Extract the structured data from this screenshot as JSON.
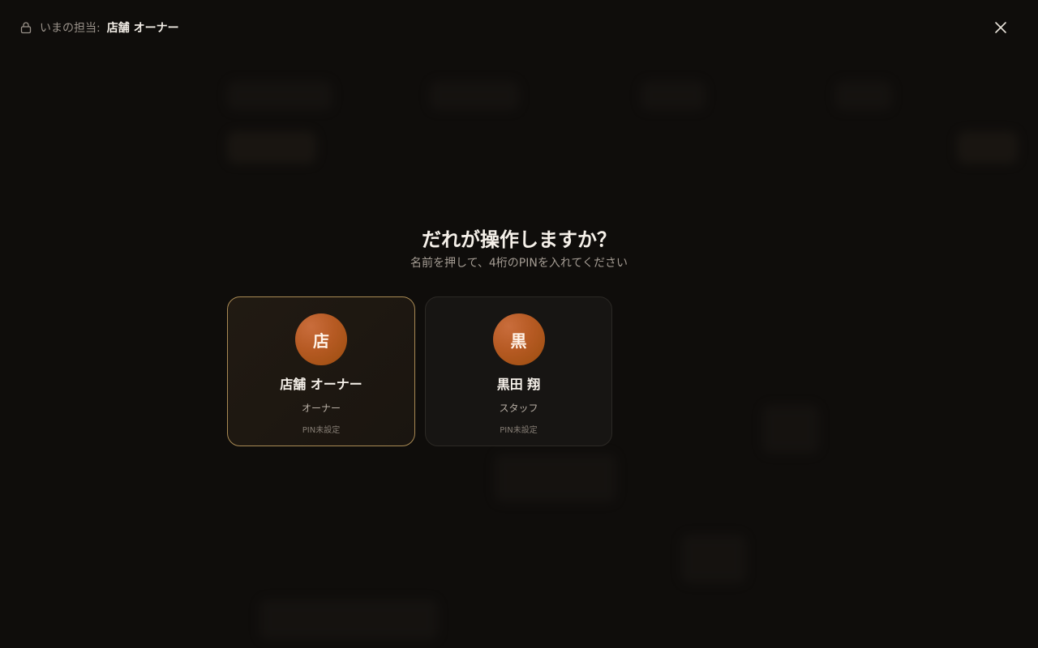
{
  "header": {
    "current_label": "いまの担当:",
    "current_name": "店舗 オーナー",
    "lock_icon": "lock-icon",
    "close_icon": "close-icon"
  },
  "prompt": {
    "title": "だれが操作しますか？",
    "subtitle": "名前を押して、4桁のPINを入れてください"
  },
  "users": [
    {
      "initial": "店",
      "name": "店舗 オーナー",
      "role": "オーナー",
      "pin_status": "PIN未設定",
      "selected": true
    },
    {
      "initial": "黒",
      "name": "黒田 翔",
      "role": "スタッフ",
      "pin_status": "PIN未設定",
      "selected": false
    }
  ],
  "colors": {
    "background": "#0f0d0b",
    "accent_border": "#a98a54",
    "avatar": "#b65a23"
  }
}
